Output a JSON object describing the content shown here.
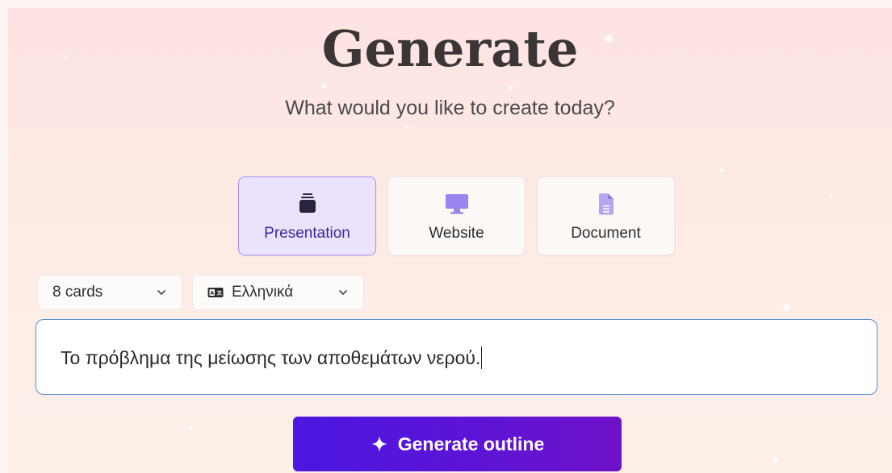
{
  "header": {
    "title": "Generate",
    "subtitle": "What would you like to create today?"
  },
  "content_types": [
    {
      "label": "Presentation",
      "icon": "stacked-cards-icon",
      "selected": true
    },
    {
      "label": "Website",
      "icon": "monitor-icon",
      "selected": false
    },
    {
      "label": "Document",
      "icon": "document-icon",
      "selected": false
    }
  ],
  "options": {
    "cards": {
      "value": "8 cards",
      "icon": "chevron-down-icon"
    },
    "language": {
      "value": "Ελληνικά",
      "icon": "language-icon"
    }
  },
  "prompt": {
    "value": "Το πρόβλημα της μείωσης των αποθεμάτων νερού."
  },
  "actions": {
    "generate_label": "Generate outline",
    "generate_icon": "sparkle-icon"
  },
  "colors": {
    "accent": "#5a18d8",
    "selected_card_bg": "#ebe3fb",
    "selected_card_border": "#a48ef0",
    "icon_purple": "#9a86ee"
  }
}
